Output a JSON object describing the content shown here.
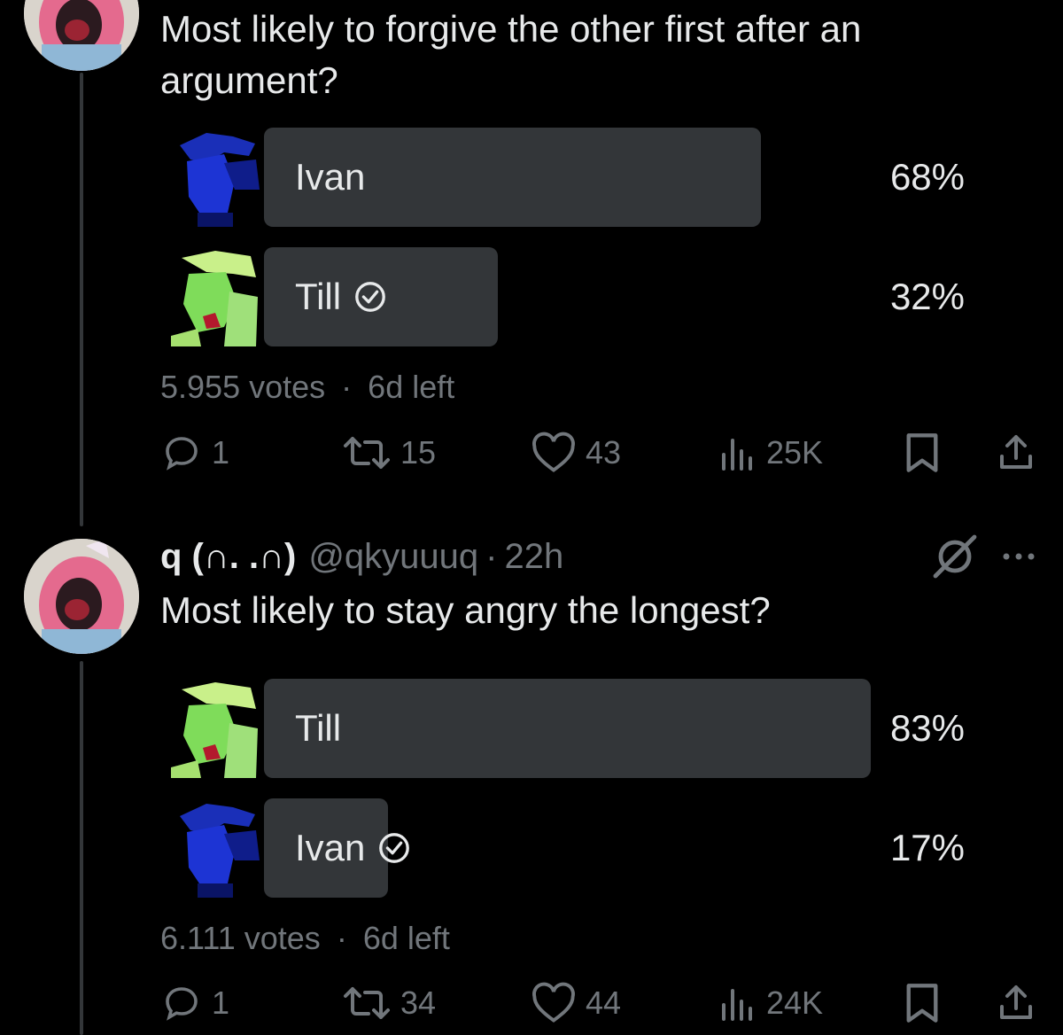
{
  "tweet1": {
    "text": "Most likely to forgive the other first after an argument?",
    "poll": [
      {
        "label": "Ivan",
        "percent": "68%",
        "fraction": 0.68,
        "winner": true,
        "verified": false,
        "thumb": "ivan"
      },
      {
        "label": "Till",
        "percent": "32%",
        "fraction": 0.32,
        "winner": false,
        "verified": true,
        "thumb": "till"
      }
    ],
    "votes": "5.955 votes",
    "time_left": "6d left",
    "replies": "1",
    "reposts": "15",
    "likes": "43",
    "views": "25K"
  },
  "tweet2": {
    "display_name": "q (∩. .∩)",
    "handle": "@qkyuuuq",
    "time": "22h",
    "text": "Most likely to stay angry the longest?",
    "poll": [
      {
        "label": "Till",
        "percent": "83%",
        "fraction": 0.83,
        "winner": true,
        "verified": false,
        "thumb": "till"
      },
      {
        "label": "Ivan",
        "percent": "17%",
        "fraction": 0.17,
        "winner": false,
        "verified": true,
        "thumb": "ivan"
      }
    ],
    "votes": "6.111 votes",
    "time_left": "6d left",
    "replies": "1",
    "reposts": "34",
    "likes": "44",
    "views": "24K"
  },
  "separator": "·",
  "colors": {
    "background": "#000000",
    "text": "#e7e9ea",
    "muted": "#71767b",
    "bar": "#333639"
  }
}
